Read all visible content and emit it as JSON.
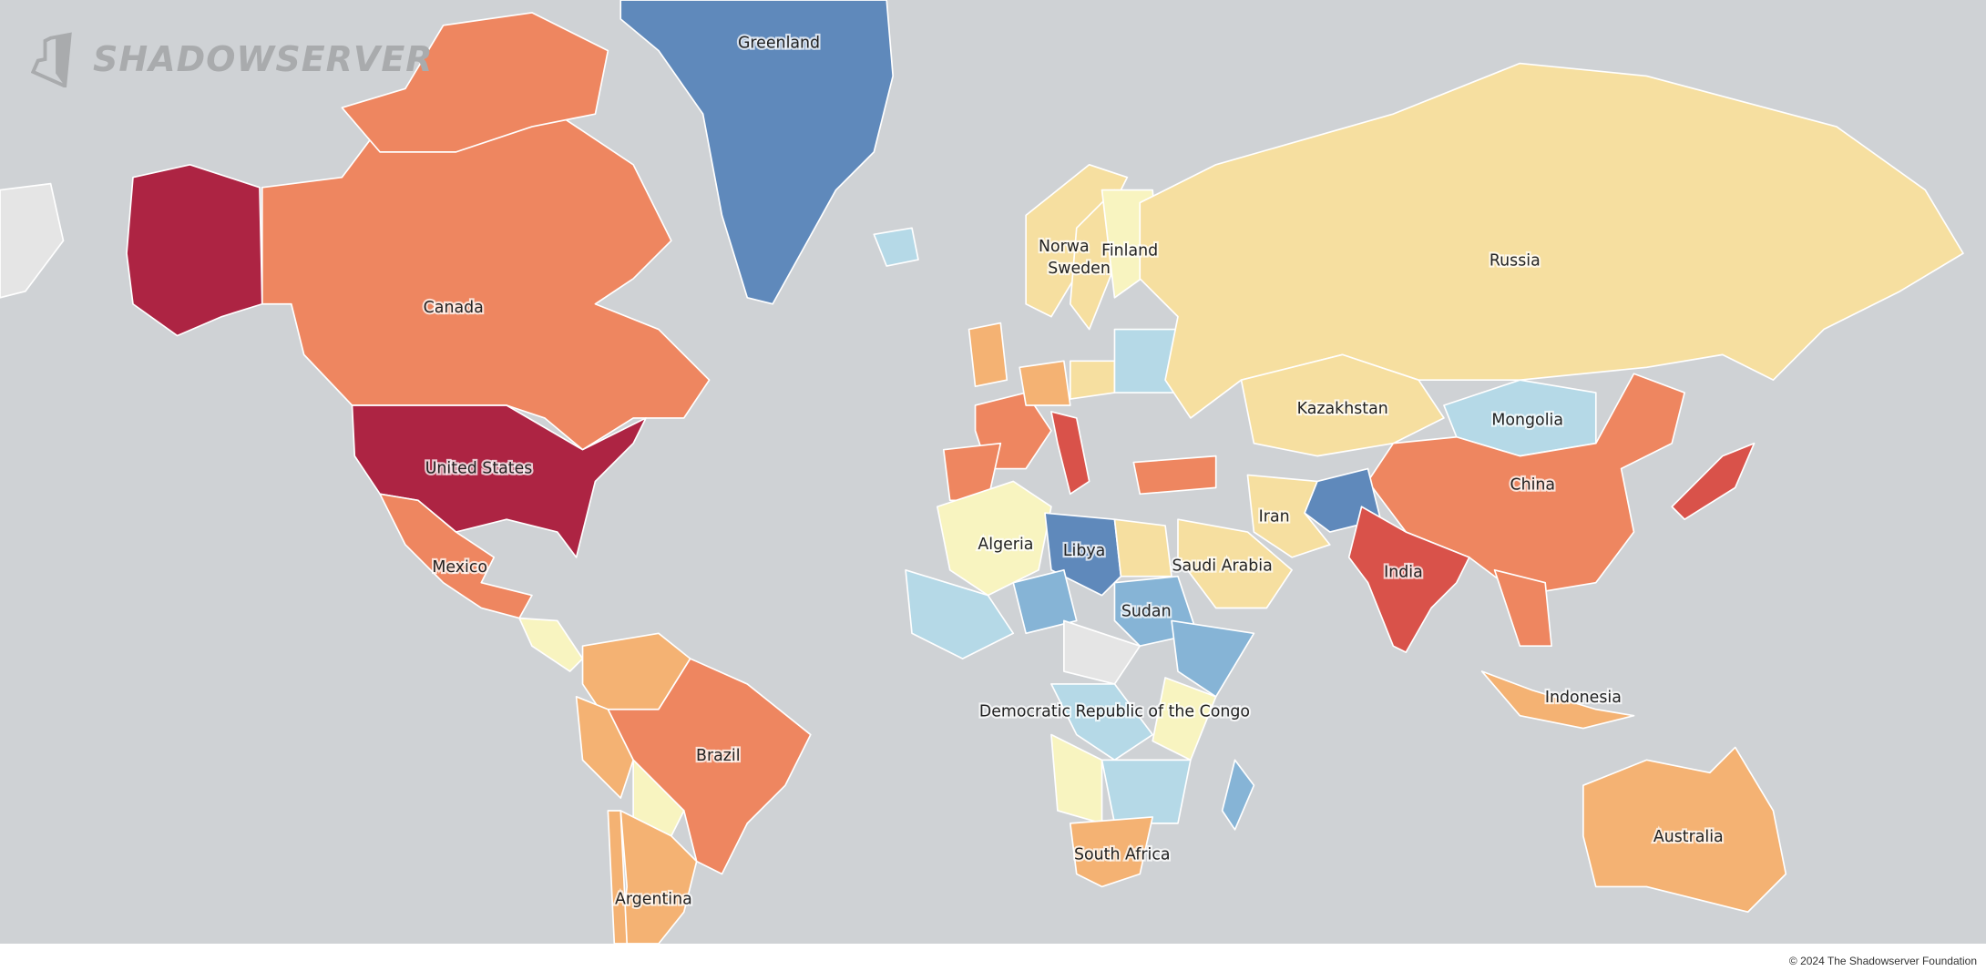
{
  "brand": {
    "name": "SHADOWSERVER"
  },
  "footer": {
    "copyright": "© 2024 The Shadowserver Foundation"
  },
  "colors": {
    "ocean": "#cfd2d5",
    "very_high": "#ad2443",
    "high": "#d9524a",
    "elevated": "#ee8660",
    "moderate": "#f4b273",
    "low": "#f6dfa0",
    "lower": "#f8f4c0",
    "minimal": "#b5d9e7",
    "very_minimal": "#86b4d6",
    "least": "#5f89bb",
    "no_data": "#e5e5e5"
  },
  "labels": [
    {
      "name": "Greenland"
    },
    {
      "name": "Canada"
    },
    {
      "name": "United States"
    },
    {
      "name": "Mexico"
    },
    {
      "name": "Brazil"
    },
    {
      "name": "Argentina"
    },
    {
      "name": "Norwa"
    },
    {
      "name": "Finland"
    },
    {
      "name": "Sweden"
    },
    {
      "name": "Russia"
    },
    {
      "name": "Kazakhstan"
    },
    {
      "name": "Mongolia"
    },
    {
      "name": "China"
    },
    {
      "name": "Iran"
    },
    {
      "name": "Algeria"
    },
    {
      "name": "Libya"
    },
    {
      "name": "Saudi Arabia"
    },
    {
      "name": "India"
    },
    {
      "name": "Sudan"
    },
    {
      "name": "Democratic Republic of the Congo"
    },
    {
      "name": "Indonesia"
    },
    {
      "name": "South Africa"
    },
    {
      "name": "Australia"
    }
  ]
}
